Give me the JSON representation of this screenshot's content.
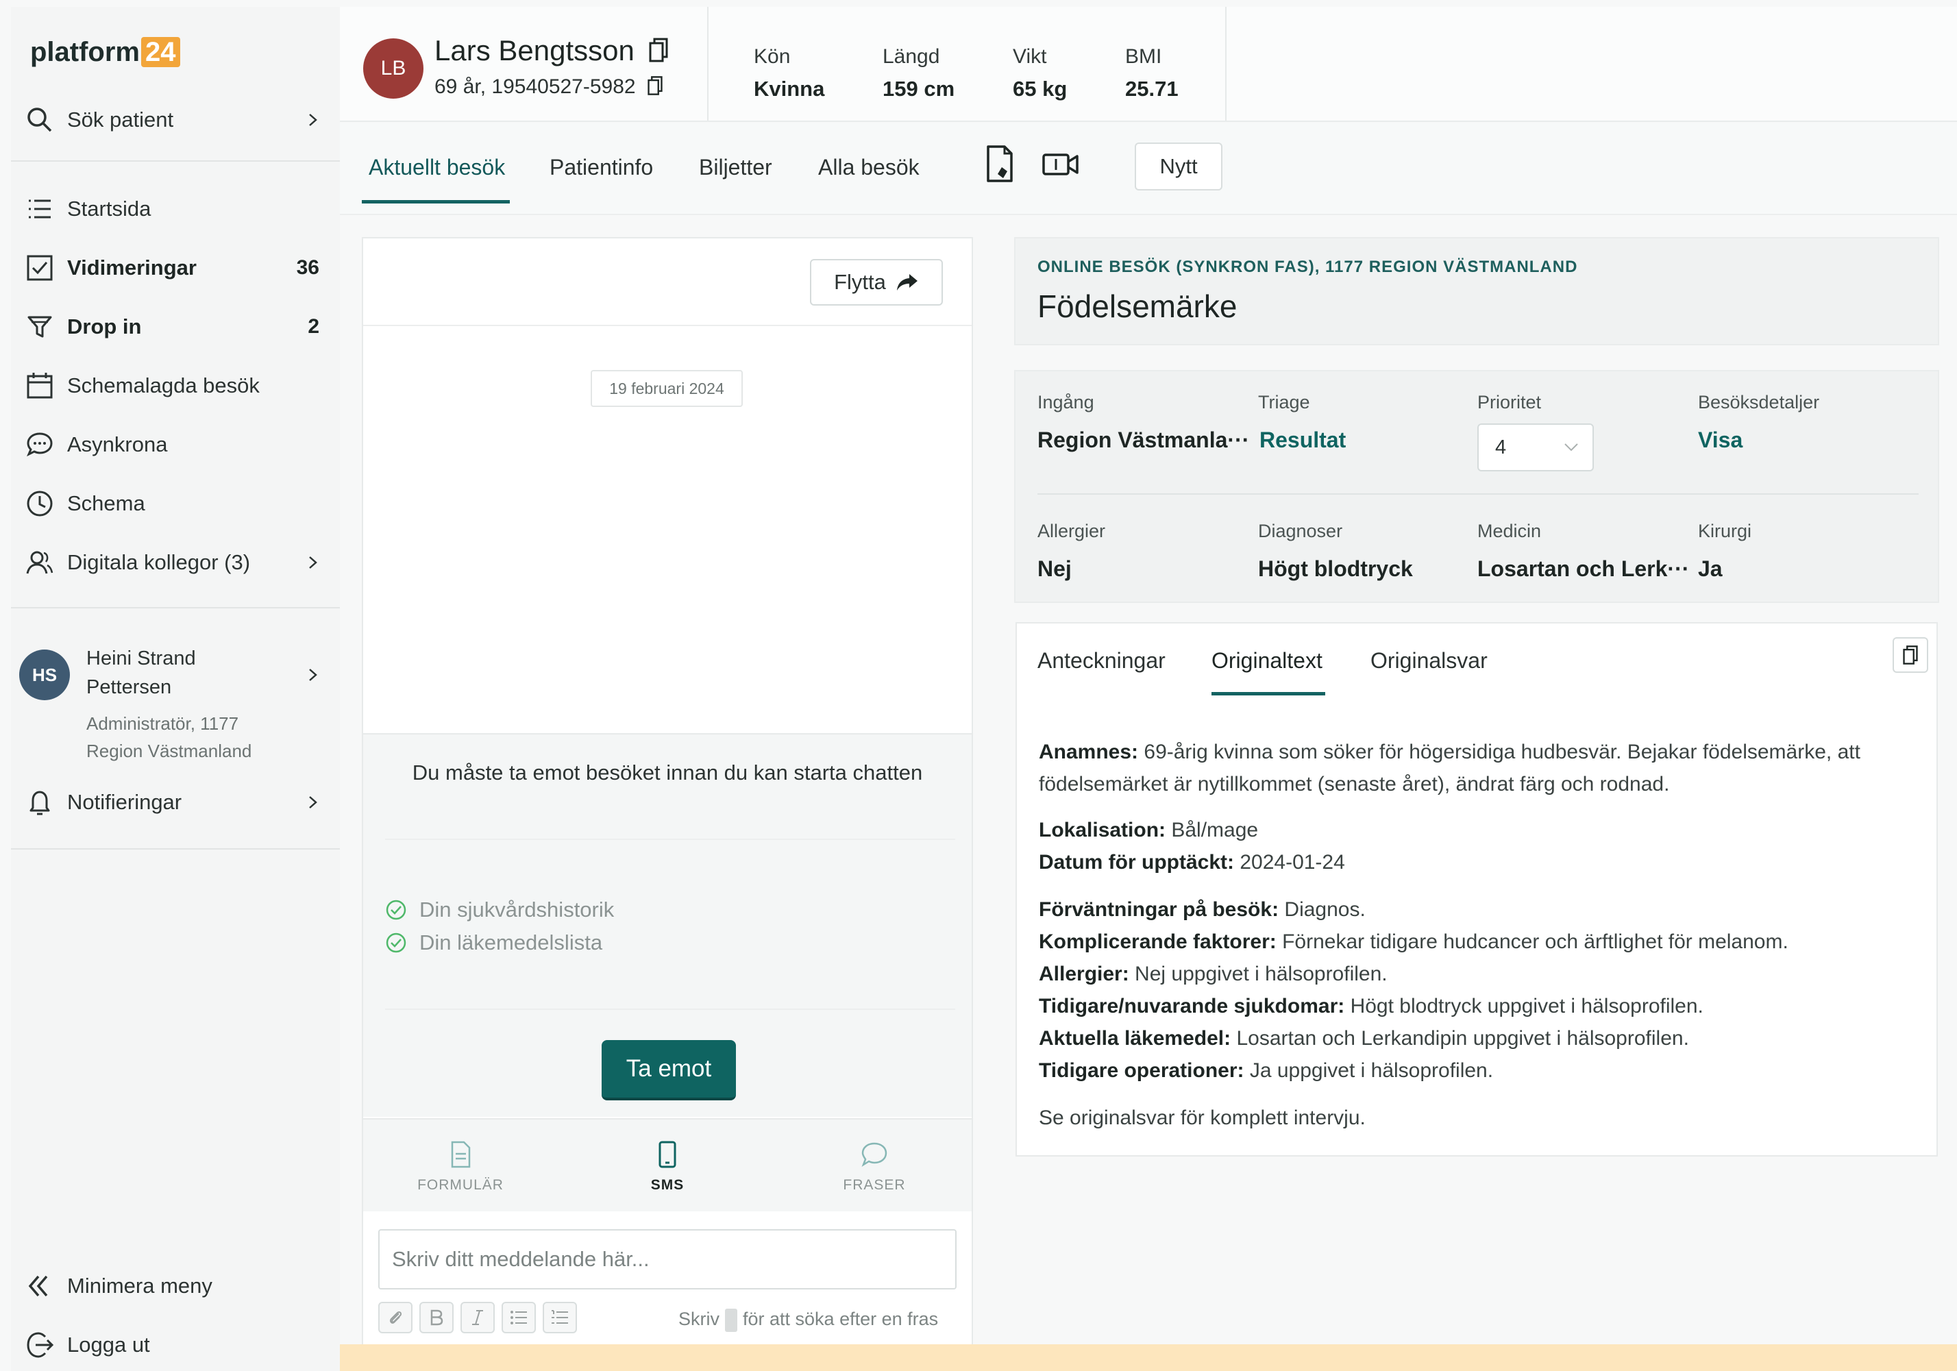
{
  "brand": {
    "name": "platform",
    "badge": "24",
    "badge_color": "#f2a53a",
    "accent": "#0f6461"
  },
  "sidebar": {
    "search": {
      "label": "Sök patient"
    },
    "items": [
      {
        "label": "Startsida",
        "icon": "list-icon",
        "count": ""
      },
      {
        "label": "Vidimeringar",
        "icon": "checkbox-icon",
        "count": "36"
      },
      {
        "label": "Drop in",
        "icon": "funnel-icon",
        "count": "2"
      },
      {
        "label": "Schemalagda besök",
        "icon": "calendar-icon",
        "count": ""
      },
      {
        "label": "Asynkrona",
        "icon": "chat-bubbles-icon",
        "count": ""
      },
      {
        "label": "Schema",
        "icon": "clock-icon",
        "count": ""
      },
      {
        "label": "Digitala kollegor (3)",
        "icon": "people-icon",
        "count": ""
      }
    ],
    "user": {
      "initials": "HS",
      "name_line1": "Heini Strand",
      "name_line2": "Pettersen",
      "role_line1": "Administratör, 1177",
      "role_line2": "Region Västmanland"
    },
    "notifications": "Notifieringar",
    "minimize": "Minimera meny",
    "logout": "Logga ut"
  },
  "patient": {
    "initials": "LB",
    "name": "Lars Bengtsson",
    "sub": "69 år, 19540527-5982",
    "stats": [
      {
        "label": "Kön",
        "value": "Kvinna"
      },
      {
        "label": "Längd",
        "value": "159 cm"
      },
      {
        "label": "Vikt",
        "value": "65 kg"
      },
      {
        "label": "BMI",
        "value": "25.71"
      }
    ]
  },
  "tabs": {
    "items": [
      "Aktuellt besök",
      "Patientinfo",
      "Biljetter",
      "Alla besök"
    ],
    "active": "Aktuellt besök",
    "new_button": "Nytt"
  },
  "chat": {
    "move_button": "Flytta",
    "date": "19 februari 2024",
    "accept_message": "Du måste ta emot besöket innan du kan starta chatten",
    "checks": [
      "Din sjukvårdshistorik",
      "Din läkemedelslista"
    ],
    "accept_button": "Ta emot",
    "bottom_tabs": [
      {
        "label": "FORMULÄR",
        "icon": "document-icon"
      },
      {
        "label": "SMS",
        "icon": "phone-icon"
      },
      {
        "label": "FRASER",
        "icon": "speech-bubble-icon"
      }
    ],
    "active_bottom_tab": "SMS",
    "input_placeholder": "Skriv ditt meddelande här...",
    "hint_prefix": "Skriv",
    "hint_suffix": "för att söka efter en fras"
  },
  "visit": {
    "kicker": "ONLINE BESÖK (SYNKRON FAS), 1177 REGION VÄSTMANLAND",
    "title": "Födelsemärke",
    "fields_row1": [
      {
        "label": "Ingång",
        "value": "Region Västmanla···"
      },
      {
        "label": "Triage",
        "value": "Resultat"
      },
      {
        "label": "Prioritet",
        "value": "4"
      },
      {
        "label": "Besöksdetaljer",
        "value": "Visa"
      }
    ],
    "fields_row2": [
      {
        "label": "Allergier",
        "value": "Nej"
      },
      {
        "label": "Diagnoser",
        "value": "Högt blodtryck"
      },
      {
        "label": "Medicin",
        "value": "Losartan och Lerk···"
      },
      {
        "label": "Kirurgi",
        "value": "Ja"
      }
    ]
  },
  "notes": {
    "tabs": [
      "Anteckningar",
      "Originaltext",
      "Originalsvar"
    ],
    "active": "Originaltext",
    "lines": [
      {
        "key": "Anamnes:",
        "text": " 69-årig kvinna som söker för högersidiga hudbesvär. Bejakar födelsemärke, att födelsemärket är nytillkommet (senaste året), ändrat färg och rodnad."
      },
      {
        "key": "Lokalisation:",
        "text": " Bål/mage"
      },
      {
        "key": "Datum för upptäckt:",
        "text": " 2024-01-24"
      },
      {
        "key": "Förväntningar på besök:",
        "text": " Diagnos."
      },
      {
        "key": "Komplicerande faktorer:",
        "text": " Förnekar tidigare hudcancer och ärftlighet för melanom."
      },
      {
        "key": "Allergier:",
        "text": " Nej uppgivet i hälsoprofilen."
      },
      {
        "key": "Tidigare/nuvarande sjukdomar:",
        "text": " Högt blodtryck uppgivet i hälsoprofilen."
      },
      {
        "key": "Aktuella läkemedel:",
        "text": " Losartan och Lerkandipin uppgivet i hälsoprofilen."
      },
      {
        "key": "Tidigare operationer:",
        "text": " Ja uppgivet i hälsoprofilen."
      }
    ],
    "footer": "Se originalsvar för komplett intervju."
  }
}
